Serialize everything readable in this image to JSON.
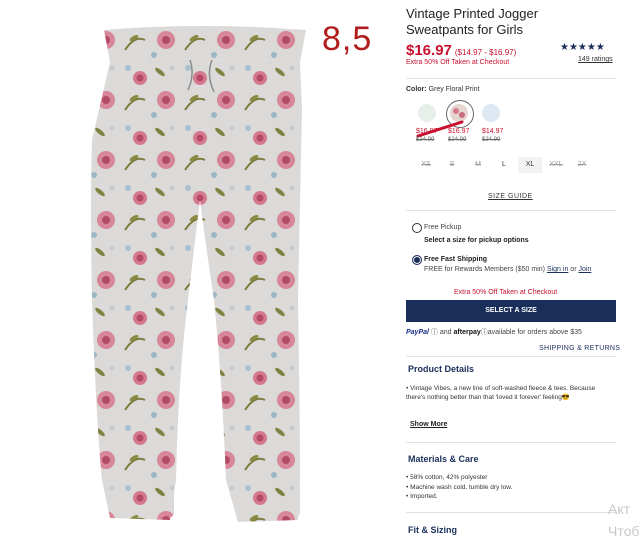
{
  "overlay_number": "8,5",
  "product": {
    "title_line1": "Vintage Printed Jogger",
    "title_line2": "Sweatpants for Girls",
    "price": "$16.97",
    "price_range": "($14.97 - $16.97)",
    "promo": "Extra 50% Off Taken at Checkout",
    "stars": "★★★★★",
    "ratings": "149 ratings",
    "rating_value": 5
  },
  "color": {
    "label": "Color:",
    "value": "Grey Floral Print",
    "swatches": [
      {
        "price": "$16.97",
        "old": "$24.99",
        "color": "#e8eee9"
      },
      {
        "price": "$16.97",
        "old": "$24.99",
        "color": "#e5d6d2"
      },
      {
        "price": "$14.97",
        "old": "$24.99",
        "color": "#dde8f2"
      }
    ]
  },
  "sizes": [
    {
      "label": "XS",
      "available": false
    },
    {
      "label": "S",
      "available": false
    },
    {
      "label": "M",
      "available": false
    },
    {
      "label": "L",
      "available": true
    },
    {
      "label": "XL",
      "available": true
    },
    {
      "label": "XXL",
      "available": false
    },
    {
      "label": "2X",
      "available": false
    }
  ],
  "size_guide": "SIZE GUIDE",
  "shipping": {
    "pickup_label": "Free Pickup",
    "pickup_sub": "Select a size for pickup options",
    "fast_label": "Free Fast Shipping",
    "fast_sub": "FREE for Rewards Members ($50 min)",
    "signin": "Sign in",
    "or": "or",
    "join": "Join"
  },
  "extra_promo": "Extra 50% Off Taken at Checkout",
  "select_size_button": "SELECT A SIZE",
  "payment": {
    "paypal": "PayPal",
    "and": "and",
    "afterpay": "afterpay",
    "available": "available for orders above $35"
  },
  "shipping_returns": "SHIPPING & RETURNS",
  "product_details": {
    "title": "Product Details",
    "bullet": "Vintage Vibes, a new line of soft-washed fleece & tees. Because there's nothing better than that 'loved it forever' feeling",
    "show_more": "Show More"
  },
  "materials": {
    "title": "Materials & Care",
    "items": [
      "58% cotton, 42% polyester",
      "Machine wash cold, tumble dry low.",
      "Imported."
    ]
  },
  "fit": {
    "title": "Fit & Sizing"
  },
  "watermark": {
    "line1": "Акт",
    "line2": "Чтоб"
  },
  "colors": {
    "brand_navy": "#1a2e5a",
    "sale_red": "#c8102e"
  }
}
